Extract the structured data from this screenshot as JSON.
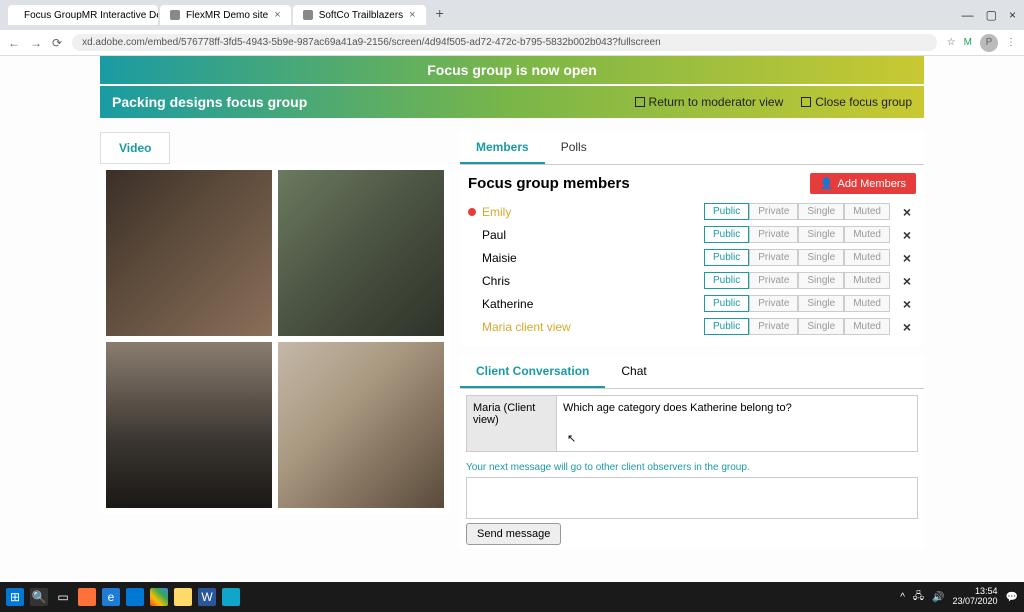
{
  "browser": {
    "tabs": [
      "Focus GroupMR Interactive Dem",
      "FlexMR Demo site",
      "SoftCo Trailblazers"
    ],
    "url": "xd.adobe.com/embed/576778ff-3fd5-4943-5b9e-987ac69a41a9-2156/screen/4d94f505-ad72-472c-b795-5832b002b043?fullscreen",
    "avatar": "P"
  },
  "banner1": "Focus group is now open",
  "banner2": {
    "title": "Packing designs focus group",
    "return": "Return to moderator view",
    "close": "Close focus group"
  },
  "video_tab": "Video",
  "member_tabs": {
    "members": "Members",
    "polls": "Polls"
  },
  "members_header": "Focus group members",
  "add_members": "Add Members",
  "pills": {
    "public": "Public",
    "private": "Private",
    "single": "Single",
    "muted": "Muted"
  },
  "members": [
    {
      "name": "Emily",
      "highlight": true,
      "dot": true
    },
    {
      "name": "Paul"
    },
    {
      "name": "Maisie"
    },
    {
      "name": "Chris"
    },
    {
      "name": "Katherine"
    },
    {
      "name": "Maria client view",
      "highlight": true
    }
  ],
  "chat_tabs": {
    "client": "Client Conversation",
    "chat": "Chat"
  },
  "message": {
    "from": "Maria (Client view)",
    "text": "Which age category does Katherine belong to?"
  },
  "hint": "Your next message will go to other client observers in the group.",
  "send": "Send message",
  "taskbar": {
    "time": "13:54",
    "date": "23/07/2020"
  }
}
